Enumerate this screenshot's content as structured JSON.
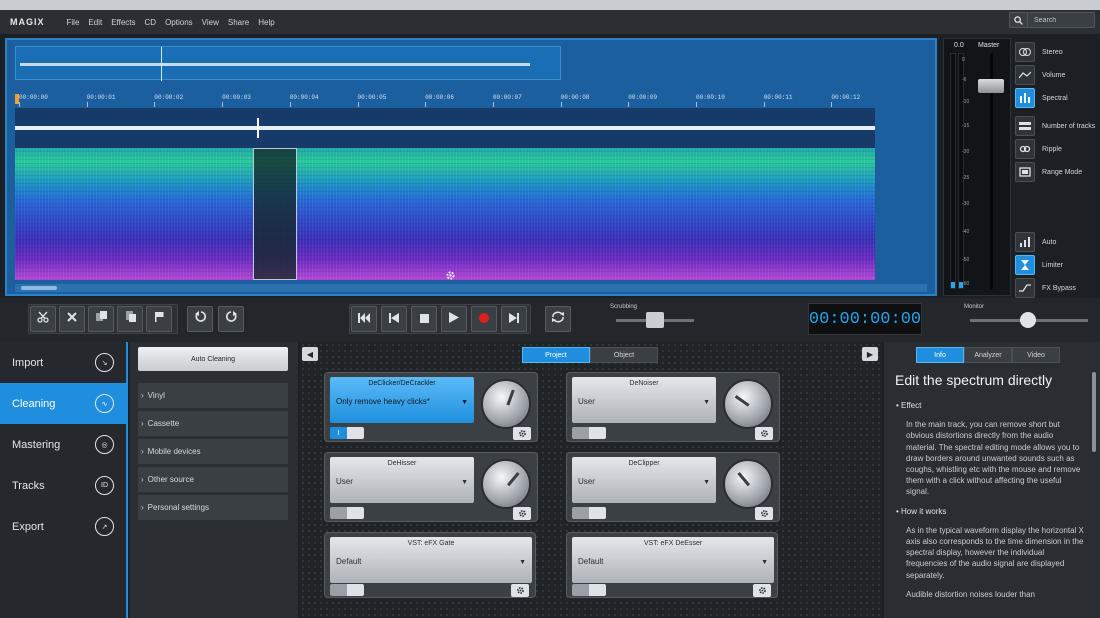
{
  "app": {
    "logo": "MAGIX",
    "menu": [
      "File",
      "Edit",
      "Effects",
      "CD",
      "Options",
      "View",
      "Share",
      "Help"
    ],
    "search_placeholder": "Search"
  },
  "timeline": {
    "ticks": [
      "00:00:00",
      "00:00:01",
      "00:00:02",
      "00:00:03",
      "00:00:04",
      "00:00:05",
      "00:00:06",
      "00:00:07",
      "00:00:08",
      "00:00:09",
      "00:00:10",
      "00:00:11",
      "00:00:12"
    ]
  },
  "mixer": {
    "level": "0.0",
    "label": "Master",
    "scale": [
      "0",
      "-6",
      "-10",
      "-15",
      "-20",
      "-25",
      "-30",
      "-40",
      "-50",
      "-60"
    ]
  },
  "tools": {
    "view": [
      {
        "label": "Stereo",
        "icon": "stereo-icon",
        "active": false
      },
      {
        "label": "Volume",
        "icon": "volume-curve-icon",
        "active": false
      },
      {
        "label": "Spectral",
        "icon": "spectral-icon",
        "active": true
      }
    ],
    "edit": [
      {
        "label": "Number of tracks",
        "icon": "tracks-icon",
        "active": false
      },
      {
        "label": "Ripple",
        "icon": "ripple-icon",
        "active": false
      },
      {
        "label": "Range Mode",
        "icon": "range-icon",
        "active": false
      }
    ],
    "dynamics": [
      {
        "label": "Auto",
        "icon": "auto-icon",
        "active": false
      },
      {
        "label": "Limiter",
        "icon": "limiter-icon",
        "active": true
      },
      {
        "label": "FX Bypass",
        "icon": "bypass-icon",
        "active": false
      }
    ]
  },
  "transport": {
    "scrubbing_label": "Scrubbing",
    "monitor_label": "Monitor",
    "time": "00:00:00:00"
  },
  "nav": [
    {
      "label": "Import",
      "icon": "import-icon",
      "active": false
    },
    {
      "label": "Cleaning",
      "icon": "cleaning-icon",
      "active": true
    },
    {
      "label": "Mastering",
      "icon": "mastering-icon",
      "active": false
    },
    {
      "label": "Tracks",
      "icon": "tracks-id-icon",
      "active": false
    },
    {
      "label": "Export",
      "icon": "export-icon",
      "active": false
    }
  ],
  "presets": {
    "auto_label": "Auto Cleaning",
    "items": [
      "Vinyl",
      "Cassette",
      "Mobile devices",
      "Other source",
      "Personal settings"
    ]
  },
  "fx_tabs": {
    "project": "Project",
    "object": "Object"
  },
  "effects": [
    {
      "name": "DeClicker/DeCrackler",
      "value": "Only remove heavy clicks*",
      "selected": true
    },
    {
      "name": "DeNoiser",
      "value": "User",
      "selected": false
    },
    {
      "name": "DeHisser",
      "value": "User",
      "selected": false
    },
    {
      "name": "DeClipper",
      "value": "User",
      "selected": false
    }
  ],
  "vst": [
    {
      "name": "VST: eFX Gate",
      "value": "Default"
    },
    {
      "name": "VST: eFX DeEsser",
      "value": "Default"
    }
  ],
  "info": {
    "tabs": [
      "Info",
      "Analyzer",
      "Video"
    ],
    "title": "Edit the spectrum directly",
    "sections": [
      {
        "heading": "Effect",
        "text": "In the main track, you can remove short but obvious distortions directly from the audio material. The spectral editing mode allows you to draw borders around unwanted sounds such as coughs, whistling etc with the mouse and remove them with a click without affecting the useful signal."
      },
      {
        "heading": "How it works",
        "text": "As in the typical waveform display the horizontal X axis also corresponds to the time dimension in the spectral display, however the individual frequencies of the audio signal are displayed separately."
      }
    ],
    "trailing": "Audible distortion noises louder than"
  }
}
